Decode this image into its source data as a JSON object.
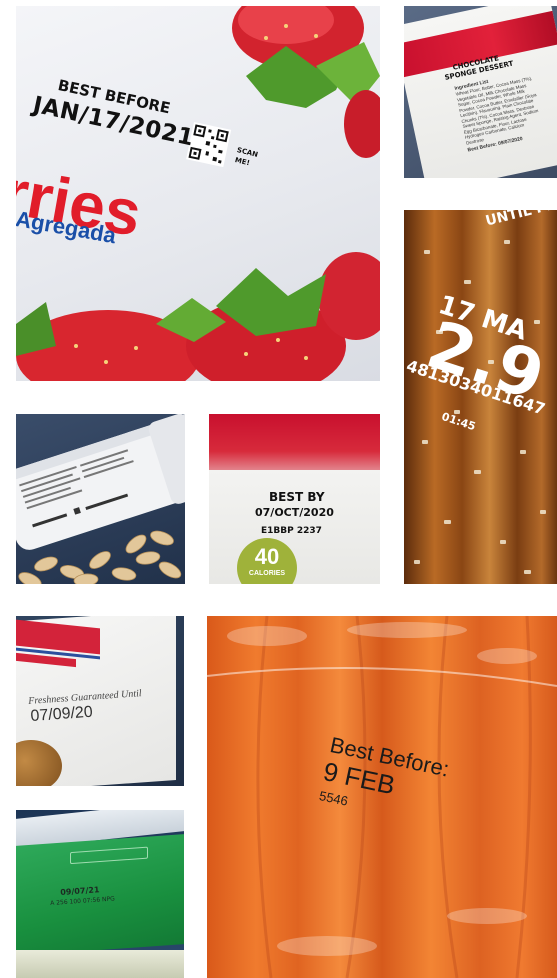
{
  "tile_strawberry": {
    "best_before": "BEST BEFORE",
    "date": "JAN/17/2021",
    "scan_line1": "SCAN",
    "scan_line2": "ME!",
    "brand_fragment": "rries",
    "sub_fragment": "Agregada",
    "colors": {
      "red": "#e11d2a",
      "blue": "#1a4fa8"
    }
  },
  "tile_sponge": {
    "title_line1": "CHOCOLATE",
    "title_line2": "SPONGE DESSERT",
    "ingredients_heading": "Ingredient List",
    "ingredients": [
      "Wheat Flour, Butter, Cocoa Mass (7%),",
      "Vegetable Oil, Milk Chocolate Mass",
      "Sugar, Cocoa Powder, Whole Milk",
      "Powder, Cocoa Butter, Emulsifier (Soya",
      "Lecithin), Flavouring, Plain Chocolate",
      "Chunks (7%), Cocoa Mass, Dextrose",
      "Sweet Sponge, Raising Agent, Sodium",
      "Egg Bicarbonate, Flour, Lactose",
      "Hydrogen Carbonate, Calcium",
      "Dextrose"
    ],
    "best_before": "Best Before: 09/07/2020"
  },
  "tile_pretzel": {
    "until": "UNTIL PR",
    "date": "17 MA",
    "price": "2.9",
    "code": "4813034011647",
    "time": "01:45"
  },
  "tile_best_by": {
    "best_by": "BEST BY",
    "date": "07/OCT/2020",
    "lot": "E1BBP  2237",
    "calories_value": "40",
    "calories_label": "CALORIES"
  },
  "tile_freshness": {
    "label": "Freshness Guaranteed Until",
    "date": "07/09/20"
  },
  "tile_green": {
    "date": "09/07/21",
    "code": "A 256 100 07:56 NPG"
  },
  "tile_carrots": {
    "line1": "Best Before:",
    "line2": "9 FEB",
    "code": "5546"
  }
}
